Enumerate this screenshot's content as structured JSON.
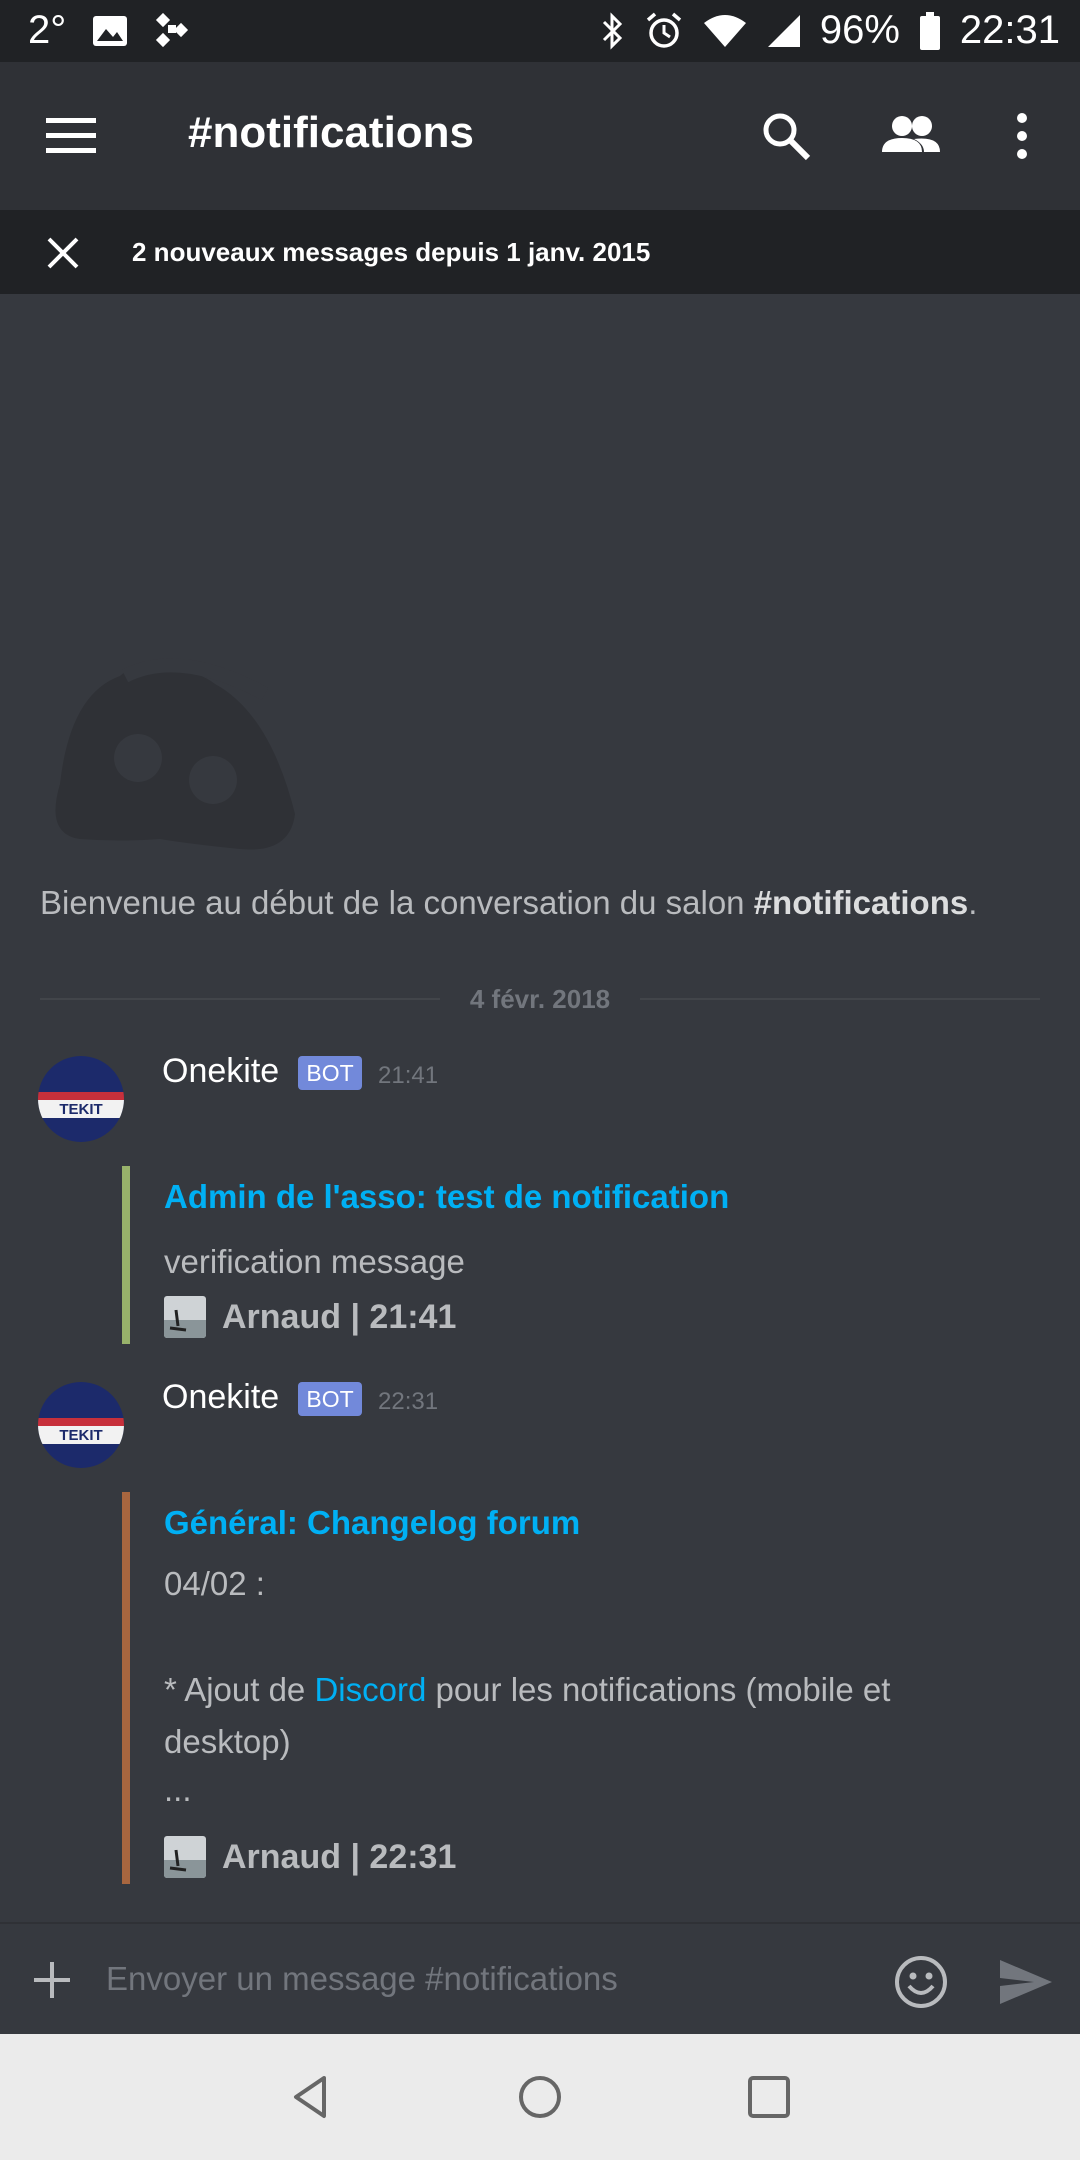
{
  "status": {
    "temperature": "2°",
    "battery": "96%",
    "time": "22:31"
  },
  "header": {
    "title": "#notifications"
  },
  "banner": {
    "text": "2 nouveaux messages depuis 1 janv. 2015"
  },
  "welcome": {
    "prefix": "Bienvenue au début de la conversation du salon ",
    "channel": "#notifications",
    "suffix": "."
  },
  "divider": {
    "date": "4 févr. 2018"
  },
  "messages": [
    {
      "author": "Onekite",
      "badge": "BOT",
      "time": "21:41",
      "embed": {
        "title": "Admin de l'asso: test de notification",
        "body": "verification message",
        "footer": "Arnaud | 21:41",
        "color": "#98b26b"
      }
    },
    {
      "author": "Onekite",
      "badge": "BOT",
      "time": "22:31",
      "embed": {
        "title": "Général: Changelog forum",
        "line1": "04/02 :",
        "line2_pre": "* Ajout de ",
        "line2_link": "Discord",
        "line2_post": " pour les notifications (mobile et",
        "line3": "desktop)",
        "line4": "...",
        "footer": "Arnaud | 22:31",
        "color": "#a8663f"
      }
    }
  ],
  "composer": {
    "placeholder": "Envoyer un message #notifications"
  },
  "colors": {
    "background": "#36393f",
    "header": "#2f3136",
    "accent_link": "#00b0f4",
    "bot_badge": "#7289da"
  },
  "icons": [
    "image-icon",
    "app-icon",
    "bluetooth-icon",
    "alarm-icon",
    "wifi-icon",
    "signal-icon",
    "battery-icon",
    "menu-icon",
    "search-icon",
    "members-icon",
    "more-icon",
    "close-icon",
    "plus-icon",
    "emoji-icon",
    "send-icon",
    "back-icon",
    "home-icon",
    "recents-icon"
  ]
}
